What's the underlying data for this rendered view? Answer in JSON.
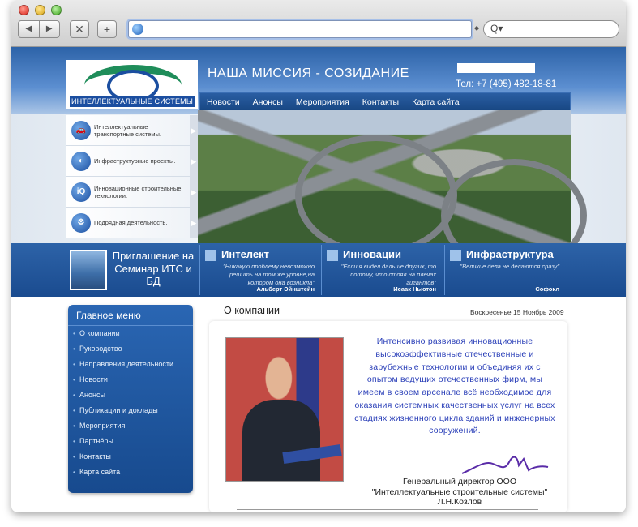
{
  "browser": {
    "nav_back": "◀",
    "nav_forward": "▶",
    "close_btn": "✕",
    "new_tab_btn": "+",
    "search_glyph": "Q▾"
  },
  "site": {
    "logo_text": "ИНТЕЛЛЕКТУАЛЬНЫЕ СИСТЕМЫ",
    "mission": "НАША МИССИЯ - СОЗИДАНИЕ",
    "phone": "Тел: +7 (495) 482-18-81",
    "nav": [
      "Новости",
      "Анонсы",
      "Мероприятия",
      "Контакты",
      "Карта сайта"
    ]
  },
  "side_nav": [
    {
      "label": "Интеллектуальные транспортные системы.",
      "icon": "car-icon",
      "glyph": "🚗"
    },
    {
      "label": "Инфраструктурные проекты.",
      "icon": "infrastructure-icon",
      "glyph": "◐"
    },
    {
      "label": "Инновационные строительные технологии.",
      "icon": "iq-icon",
      "glyph": "iQ"
    },
    {
      "label": "Подрядная деятельность.",
      "icon": "gears-icon",
      "glyph": "⚙"
    }
  ],
  "banner": {
    "invite": "Приглашение на Семинар ИТС и БД",
    "columns": [
      {
        "title": "Интелект",
        "quote": "\"Никакую проблему невозможно решить на том же уровне,на котором она возникла\"",
        "author": "Альберт Эйнштейн"
      },
      {
        "title": "Инновации",
        "quote": "\"Если я видел дальше других, то потому, что стоял на плечах гигантов\"",
        "author": "Исаак Ньютон"
      },
      {
        "title": "Инфраструктура",
        "quote": "\"Великие дела не делаются сразу\"",
        "author": "Софокл"
      }
    ]
  },
  "main_menu": {
    "title": "Главное меню",
    "items": [
      "О компании",
      "Руководство",
      "Направления деятельности",
      "Новости",
      "Анонсы",
      "Публикации и доклады",
      "Мероприятия",
      "Партнёры",
      "Контакты",
      "Карта сайта"
    ]
  },
  "content": {
    "heading": "О компании",
    "date": "Воскресенье 15 Ноябрь 2009",
    "body": "Интенсивно развивая инновационные высокоэффективные отечественные и зарубежные технологии и объединяя их с опытом ведущих отечественных фирм, мы имеем в своем арсенале всё необходимое для оказания системных качественных услуг на всех стадиях жизненного цикла зданий и инженерных сооружений.",
    "signer_line1": "Генеральный директор ООО",
    "signer_line2": "\"Интеллектуальные строительные системы\"",
    "signer_line3": "Л.Н.Козлов"
  }
}
